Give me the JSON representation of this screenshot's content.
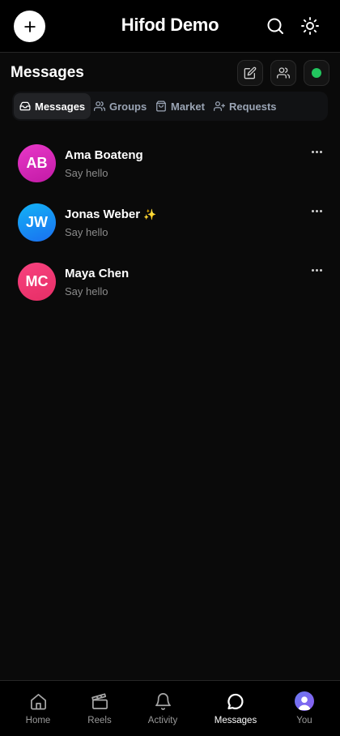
{
  "header": {
    "title": "Hifod Demo",
    "add_icon": "plus-icon",
    "search_icon": "search-icon",
    "theme_icon": "sun-icon"
  },
  "section": {
    "title": "Messages",
    "compose_icon": "edit-icon",
    "people_icon": "users-icon",
    "status_color": "#22c55e"
  },
  "tabs": [
    {
      "label": "Messages",
      "icon": "inbox-icon",
      "active": true
    },
    {
      "label": "Groups",
      "icon": "users-icon",
      "active": false
    },
    {
      "label": "Market",
      "icon": "shopping-bag-icon",
      "active": false
    },
    {
      "label": "Requests",
      "icon": "user-plus-icon",
      "active": false
    }
  ],
  "conversations": [
    {
      "initials": "AB",
      "name": "Ama Boateng",
      "badge": "",
      "preview": "Say hello",
      "colors": [
        "#e838c8",
        "#c21aa6"
      ]
    },
    {
      "initials": "JW",
      "name": "Jonas Weber",
      "badge": "✨",
      "preview": "Say hello",
      "colors": [
        "#13b3f6",
        "#1a6ff0"
      ]
    },
    {
      "initials": "MC",
      "name": "Maya Chen",
      "badge": "",
      "preview": "Say hello",
      "colors": [
        "#f8427f",
        "#e62e66"
      ]
    }
  ],
  "bottom_nav": [
    {
      "label": "Home",
      "icon": "home-icon",
      "active": false
    },
    {
      "label": "Reels",
      "icon": "clapperboard-icon",
      "active": false
    },
    {
      "label": "Activity",
      "icon": "bell-icon",
      "active": false
    },
    {
      "label": "Messages",
      "icon": "message-circle-icon",
      "active": true
    },
    {
      "label": "You",
      "icon": "user-avatar-icon",
      "active": false
    }
  ]
}
